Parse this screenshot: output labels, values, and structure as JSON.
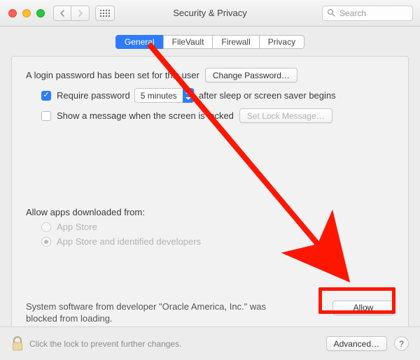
{
  "window": {
    "title": "Security & Privacy",
    "search_placeholder": "Search"
  },
  "tabs": {
    "general": "General",
    "filevault": "FileVault",
    "firewall": "Firewall",
    "privacy": "Privacy"
  },
  "general": {
    "login_pw_text": "A login password has been set for this user",
    "change_pw_btn": "Change Password…",
    "require_pw_label": "Require password",
    "require_pw_delay": "5 minutes",
    "require_pw_tail": "after sleep or screen saver begins",
    "show_msg_label": "Show a message when the screen is locked",
    "set_lock_btn": "Set Lock Message…",
    "allow_header": "Allow apps downloaded from:",
    "radio_appstore": "App Store",
    "radio_identified": "App Store and identified developers",
    "blocked_text": "System software from developer \"Oracle America, Inc.\" was blocked from loading.",
    "allow_btn": "Allow"
  },
  "bottom": {
    "lock_text": "Click the lock to prevent further changes.",
    "advanced_btn": "Advanced…",
    "help": "?"
  },
  "annotation": {
    "highlight_color": "#ff1600"
  }
}
